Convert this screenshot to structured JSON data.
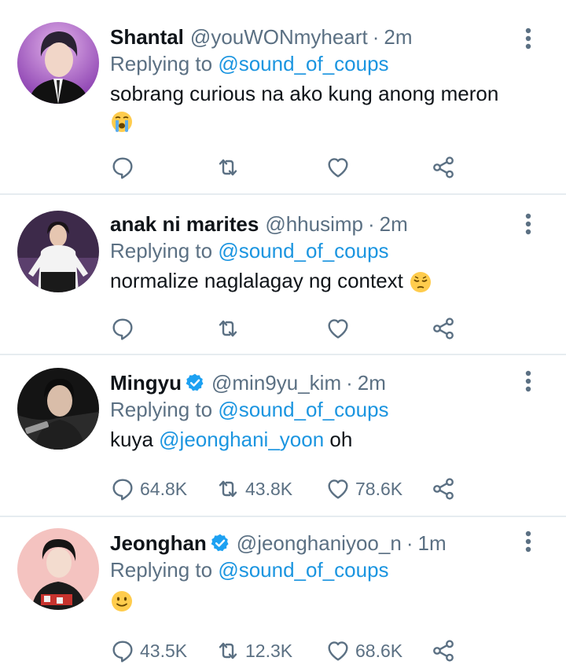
{
  "tweets": [
    {
      "name": "Shantal",
      "verified": false,
      "handle": "@youWONmyheart",
      "dot": "·",
      "time": "2m",
      "replying_prefix": "Replying to",
      "replying_handle": "@sound_of_coups",
      "text_before": "sobrang curious na ako kung anong meron",
      "emoji": "loudly-crying-face",
      "replies": "",
      "retweets": "",
      "likes": ""
    },
    {
      "name": "anak ni marites",
      "verified": false,
      "handle": "@hhusimp",
      "dot": "·",
      "time": "2m",
      "replying_prefix": "Replying to",
      "replying_handle": "@sound_of_coups",
      "text_before": "normalize naglalagay ng context",
      "emoji": "pensive-face",
      "replies": "",
      "retweets": "",
      "likes": ""
    },
    {
      "name": "Mingyu",
      "verified": true,
      "handle": "@min9yu_kim",
      "dot": "·",
      "time": "2m",
      "replying_prefix": "Replying to",
      "replying_handle": "@sound_of_coups",
      "text_before": "kuya",
      "text_mention": "@jeonghani_yoon",
      "text_after": "oh",
      "replies": "64.8K",
      "retweets": "43.8K",
      "likes": "78.6K"
    },
    {
      "name": "Jeonghan",
      "verified": true,
      "handle": "@jeonghaniyoo_n",
      "dot": "·",
      "time": "1m",
      "replying_prefix": "Replying to",
      "replying_handle": "@sound_of_coups",
      "emoji": "slightly-smiling-face",
      "replies": "43.5K",
      "retweets": "12.3K",
      "likes": "68.6K"
    }
  ],
  "colors": {
    "secondary_text": "#5b7083",
    "link": "#1b95e0",
    "verified": "#1da1f2",
    "divider": "#e6ecf0"
  },
  "icons": [
    "reply-icon",
    "retweet-icon",
    "like-icon",
    "share-icon",
    "more-icon",
    "verified-badge-icon"
  ]
}
